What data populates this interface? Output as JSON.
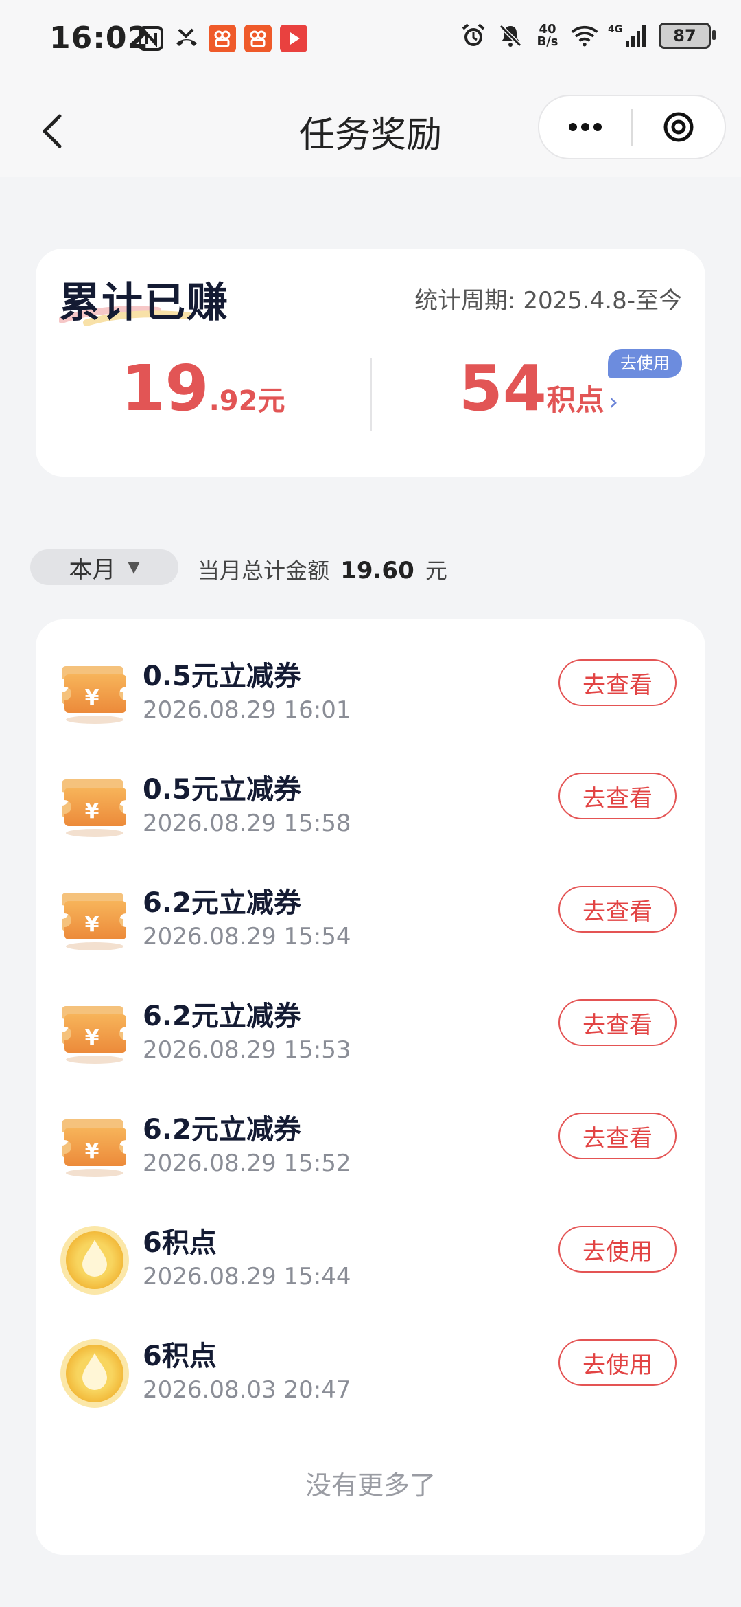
{
  "status_bar": {
    "time": "16:02",
    "net_speed_top": "40",
    "net_speed_bottom": "B/s",
    "battery": "87",
    "network_label": "4G"
  },
  "nav": {
    "title": "任务奖励"
  },
  "earned": {
    "title": "累计已赚",
    "period": "统计周期: 2025.4.8-至今",
    "money_int": "19",
    "money_dec": ".92",
    "money_unit": "元",
    "points_value": "54",
    "points_unit": "积点",
    "points_chevron": "›",
    "use_badge": "去使用"
  },
  "filter": {
    "month_label": "本月",
    "caret": "▼",
    "total_prefix": "当月总计金额",
    "total_value": "19.60",
    "total_unit": "元"
  },
  "rewards": [
    {
      "name": "0.5元立减券",
      "time": "2026.08.29 16:01",
      "action": "去查看",
      "icon": "coupon-icon"
    },
    {
      "name": "0.5元立减券",
      "time": "2026.08.29 15:58",
      "action": "去查看",
      "icon": "coupon-icon"
    },
    {
      "name": "6.2元立减券",
      "time": "2026.08.29 15:54",
      "action": "去查看",
      "icon": "coupon-icon"
    },
    {
      "name": "6.2元立减券",
      "time": "2026.08.29 15:53",
      "action": "去查看",
      "icon": "coupon-icon"
    },
    {
      "name": "6.2元立减券",
      "time": "2026.08.29 15:52",
      "action": "去查看",
      "icon": "coupon-icon"
    },
    {
      "name": "6积点",
      "time": "2026.08.29 15:44",
      "action": "去使用",
      "icon": "points-coin-icon"
    },
    {
      "name": "6积点",
      "time": "2026.08.03 20:47",
      "action": "去使用",
      "icon": "points-coin-icon"
    }
  ],
  "footer": {
    "no_more": "没有更多了"
  },
  "colors": {
    "accent_red": "#e25555",
    "badge_blue": "#6c8cde",
    "coupon_orange": "#f2a24a",
    "coin_gold": "#f5c84a"
  }
}
